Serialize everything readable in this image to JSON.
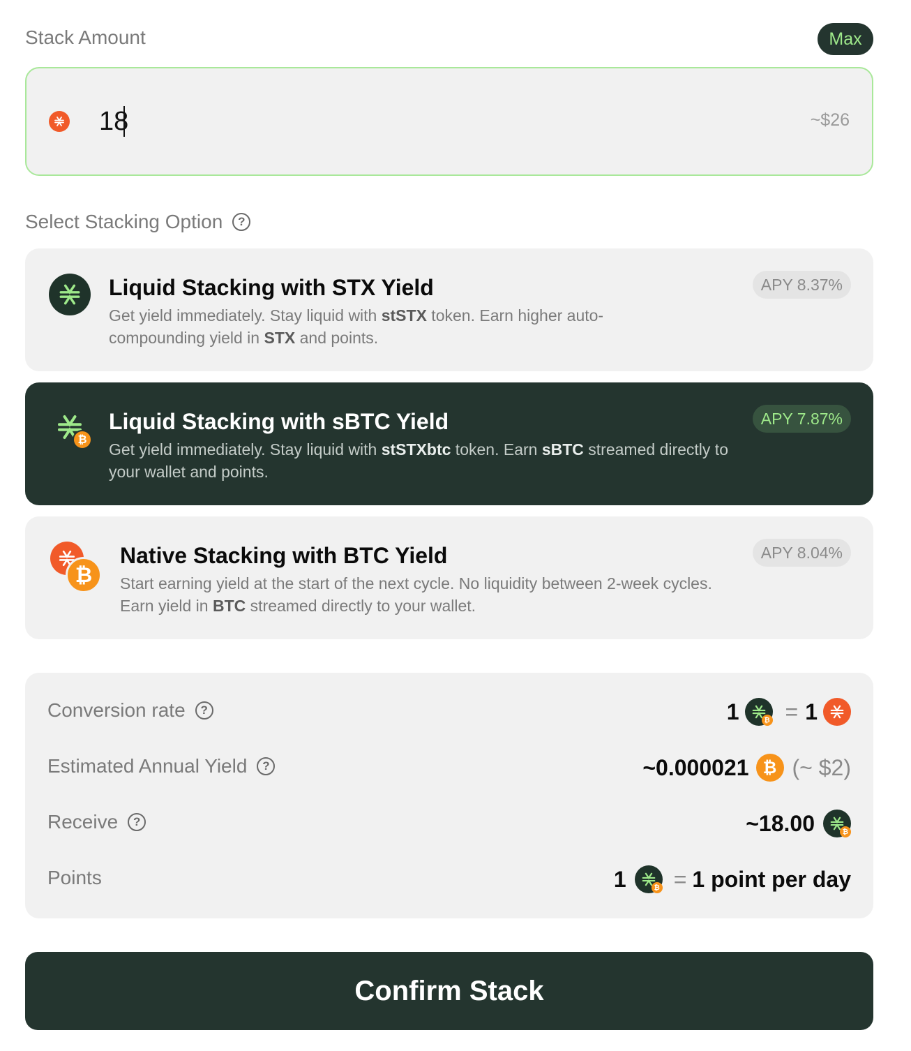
{
  "stack_amount": {
    "label": "Stack Amount",
    "max_label": "Max",
    "value": "18",
    "usd_estimate": "~$26"
  },
  "options_section": {
    "label": "Select Stacking Option",
    "options": [
      {
        "title": "Liquid Stacking with STX Yield",
        "apy": "APY 8.37%",
        "desc_parts": [
          "Get yield immediately. Stay liquid with ",
          "stSTX",
          " token. Earn higher auto-compounding yield in ",
          "STX",
          " and points."
        ],
        "selected": false
      },
      {
        "title": "Liquid Stacking with sBTC Yield",
        "apy": "APY 7.87%",
        "desc_parts": [
          "Get yield immediately. Stay liquid with ",
          "stSTXbtc",
          " token. Earn ",
          "sBTC",
          " streamed directly to your wallet and points."
        ],
        "selected": true
      },
      {
        "title": "Native Stacking with BTC Yield",
        "apy": "APY 8.04%",
        "desc_parts": [
          "Start earning yield at the start of the next cycle. No liquidity between 2-week cycles. Earn yield in ",
          "BTC",
          " streamed directly to your wallet."
        ],
        "selected": false
      }
    ]
  },
  "summary": {
    "conversion_rate": {
      "label": "Conversion rate",
      "left_amount": "1",
      "equals": "=",
      "right_amount": "1"
    },
    "annual_yield": {
      "label": "Estimated Annual Yield",
      "amount": "~0.000021",
      "usd": "(~ $2)"
    },
    "receive": {
      "label": "Receive",
      "amount": "~18.00"
    },
    "points": {
      "label": "Points",
      "amount": "1",
      "equals": "=",
      "rate": "1 point per day"
    }
  },
  "confirm_label": "Confirm Stack",
  "colors": {
    "brand_dark": "#24352f",
    "accent_green": "#9ee98a",
    "stx_orange": "#f15a29",
    "btc_orange": "#f7931a"
  },
  "icons": [
    "stx-icon",
    "ststx-icon",
    "ststxbtc-icon",
    "btc-icon",
    "help-icon"
  ]
}
